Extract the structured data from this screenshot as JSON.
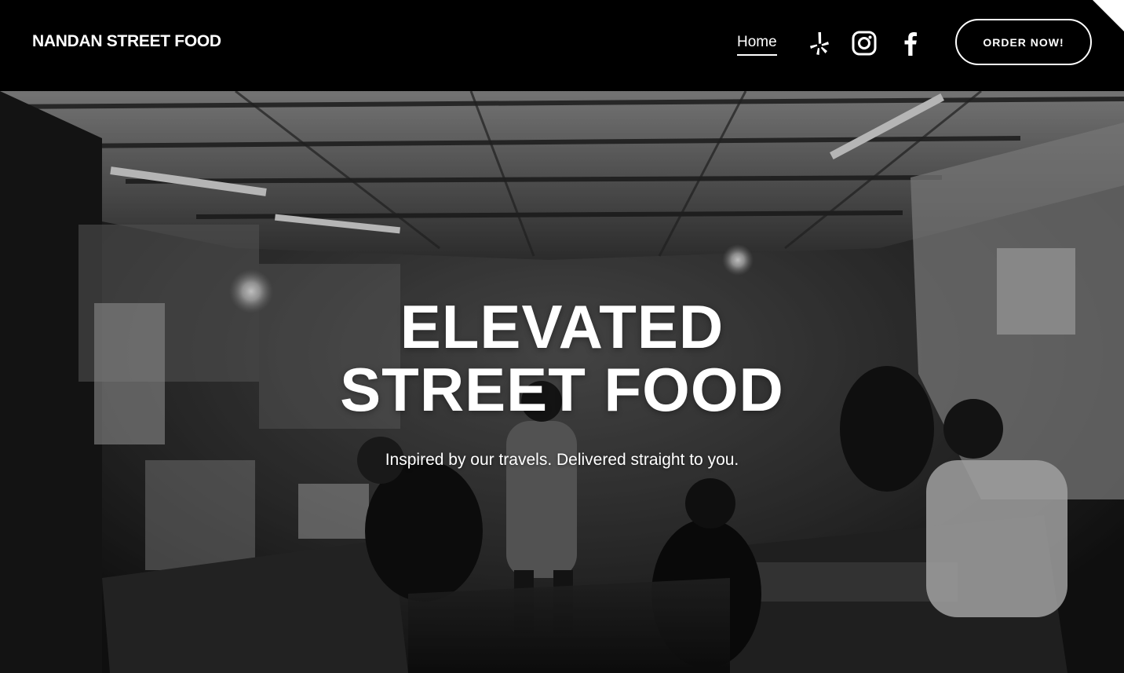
{
  "header": {
    "site_title": "NANDAN STREET FOOD",
    "nav": [
      {
        "label": "Home",
        "active": true
      }
    ],
    "social_icons": [
      "yelp-icon",
      "instagram-icon",
      "facebook-icon"
    ],
    "cta_label": "ORDER NOW!"
  },
  "hero": {
    "headline_line1": "ELEVATED",
    "headline_line2": "STREET FOOD",
    "subtitle": "Inspired by our travels. Delivered straight to you."
  },
  "colors": {
    "background": "#000000",
    "text": "#ffffff"
  }
}
